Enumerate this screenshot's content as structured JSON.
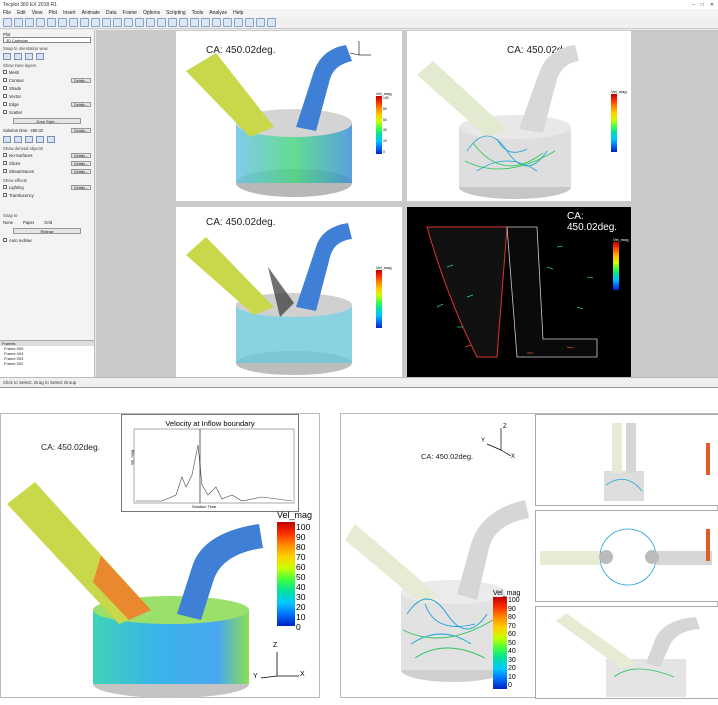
{
  "app": {
    "title": "Tecplot 360 EX 2018 R1",
    "menu": [
      "File",
      "Edit",
      "View",
      "Plot",
      "Insert",
      "Animate",
      "Data",
      "Frame",
      "Options",
      "Scripting",
      "Tools",
      "Analyze",
      "Help"
    ],
    "status": "Click to Select, Drag to Select Group"
  },
  "sidebar": {
    "section_plot": "Plot",
    "plot_type": "3D Cartesian",
    "snap_label": "Snap to orientation view",
    "show_zone_layers": "Show zone layers",
    "layers": [
      {
        "label": "Mesh",
        "details": false
      },
      {
        "label": "Contour",
        "details": true
      },
      {
        "label": "Shade",
        "details": false
      },
      {
        "label": "Vector",
        "details": false
      },
      {
        "label": "Edge",
        "details": true
      },
      {
        "label": "Scatter",
        "details": false
      }
    ],
    "zone_style": "Zone Style...",
    "solution_time_label": "Solution time:",
    "solution_time_value": "450.02",
    "details": "Details...",
    "show_derived": "Show derived objects",
    "derived": [
      "Iso-Surfaces",
      "Slices",
      "Streamtraces"
    ],
    "show_effects": "Show effects",
    "effects": [
      "Lighting",
      "Translucency"
    ],
    "snap_to": "Snap to",
    "snap_opts": [
      "None",
      "Paper",
      "Grid"
    ],
    "redraw": "Redraw",
    "auto_redraw": "Auto redraw",
    "frames_header": "Frames",
    "frames": [
      "Frame 005",
      "Frame 004",
      "Frame 003",
      "Frame 002"
    ]
  },
  "ca_label": "CA: 450.02deg.",
  "legend": {
    "title": "Vel_mag",
    "ticks": [
      "100",
      "90",
      "80",
      "70",
      "60",
      "50",
      "40",
      "30",
      "20",
      "10",
      "0"
    ]
  },
  "inset_chart": {
    "title": "Velocity at Inflow boundary",
    "ylabel": "Vel_mag",
    "xlabel": "Solution Time"
  },
  "axes": {
    "x": "X",
    "y": "Y",
    "z": "Z"
  },
  "colors": {
    "accent": "#1f6fd1",
    "pipe_yellow": "#c9d84a",
    "pipe_blue": "#3f7fd6",
    "cylinder": "#d0d0d0"
  },
  "icons": [
    "new-icon",
    "open-icon",
    "save-icon",
    "select-icon",
    "zoom-icon",
    "rotate-icon",
    "probe-icon"
  ]
}
